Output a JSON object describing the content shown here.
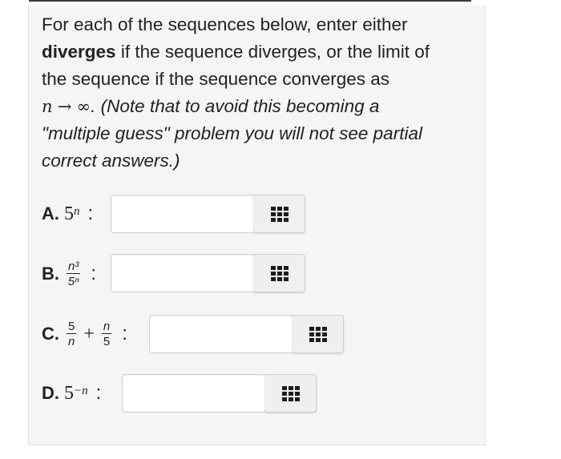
{
  "intro": {
    "line1": "For each of the sequences below, enter either",
    "bold_word": "diverges",
    "line2_rest": " if the sequence diverges, or the limit of",
    "line3": "the sequence if the sequence converges as",
    "math_var": "n",
    "math_arrow": "→",
    "math_inf": "∞",
    "line4_rest": ". (Note that to avoid this becoming a",
    "line5": "\"multiple guess\" problem you will not see partial",
    "line6": "correct answers.)"
  },
  "items": [
    {
      "label": "A.",
      "base": "5",
      "sup": "n",
      "value": ""
    },
    {
      "label": "B.",
      "num": "n³",
      "den": "5ⁿ",
      "value": ""
    },
    {
      "label": "C.",
      "frac1_num": "5",
      "frac1_den": "n",
      "plus": "+",
      "frac2_num": "n",
      "frac2_den": "5",
      "value": ""
    },
    {
      "label": "D.",
      "base": "5",
      "sup": "−n",
      "value": ""
    }
  ],
  "colon": ":",
  "icon": "equation-editor-grid-icon"
}
